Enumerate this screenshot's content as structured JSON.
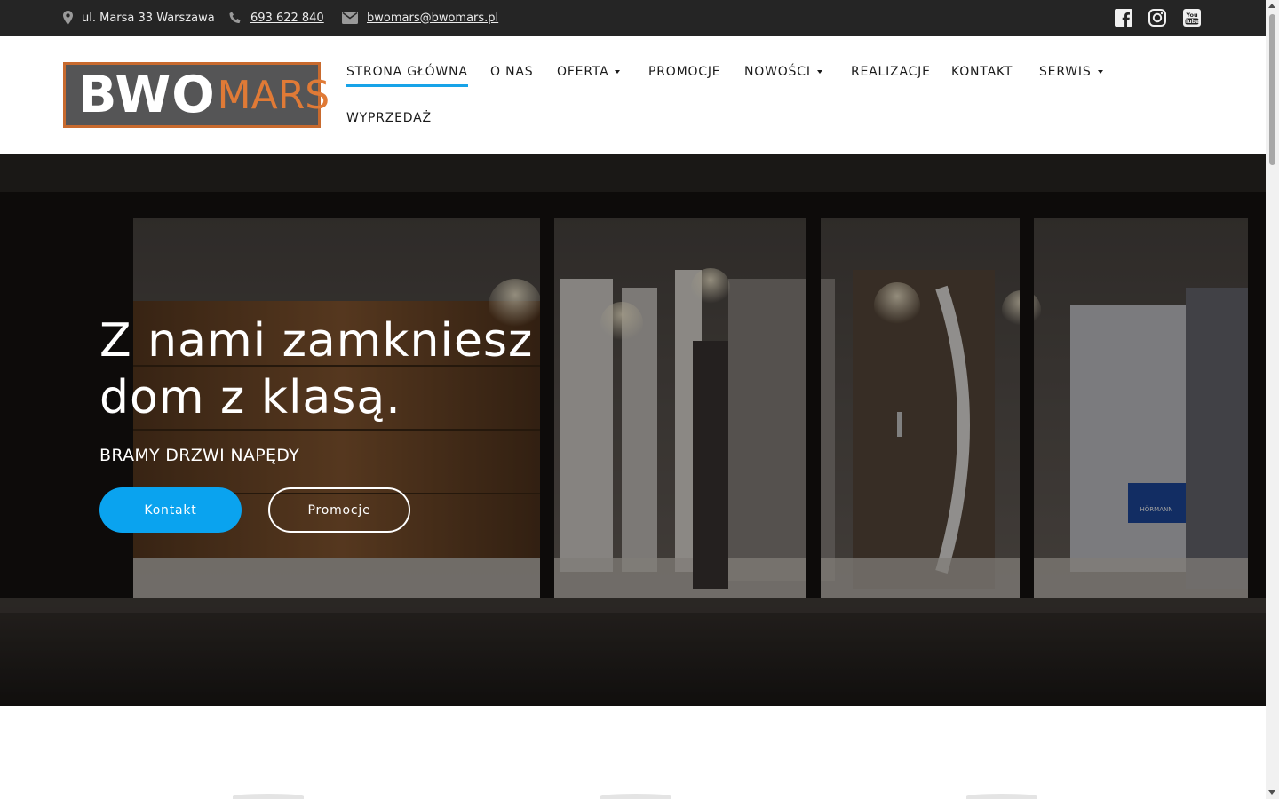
{
  "topbar": {
    "address": "ul. Marsa 33 Warszawa",
    "phone": "693 622 840",
    "email": "bwomars@bwomars.pl",
    "icons": [
      "map-marker-icon",
      "phone-icon",
      "envelope-icon",
      "facebook-icon",
      "instagram-icon",
      "youtube-icon"
    ]
  },
  "logo": {
    "part1": "BWO",
    "part2": "MARS"
  },
  "nav": {
    "items": [
      {
        "label": "STRONA GŁÓWNA",
        "active": true
      },
      {
        "label": "O NAS"
      },
      {
        "label": "OFERTA",
        "dropdown": true
      },
      {
        "label": "PROMOCJE"
      },
      {
        "label": "NOWOŚCI",
        "dropdown": true
      },
      {
        "label": "REALIZACJE"
      },
      {
        "label": "KONTAKT"
      },
      {
        "label": "SERWIS",
        "dropdown": true
      },
      {
        "label": "WYPRZEDAŻ"
      }
    ]
  },
  "hero": {
    "title_line1": "Z nami zamkniesz",
    "title_line2": "dom z klasą.",
    "subtitle": "BRAMY DRZWI NAPĘDY",
    "primary_button": "Kontakt",
    "secondary_button": "Promocje",
    "sign_text": "HÖRMANN"
  },
  "colors": {
    "topbar_bg": "#252525",
    "accent": "#0aa3ef",
    "logo_orange": "#c86a2e",
    "logo_gray": "#555556"
  }
}
